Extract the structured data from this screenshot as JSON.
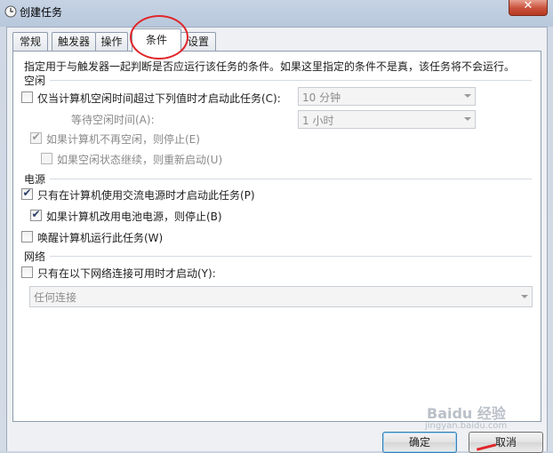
{
  "window": {
    "title": "创建任务",
    "close_glyph": "✕"
  },
  "tabs": [
    {
      "label": "常规",
      "active": false
    },
    {
      "label": "触发器",
      "active": false
    },
    {
      "label": "操作",
      "active": false
    },
    {
      "label": "条件",
      "active": true
    },
    {
      "label": "设置",
      "active": false
    }
  ],
  "conditions": {
    "description": "指定用于与触发器一起判断是否应运行该任务的条件。如果这里指定的条件不是真，该任务将不会运行。",
    "idle": {
      "heading": "空闲",
      "start_only_if_idle": {
        "label": "仅当计算机空闲时间超过下列值时才启动此任务(C):",
        "checked": false
      },
      "idle_duration": {
        "value": "10 分钟"
      },
      "wait_for_idle": {
        "label": "等待空闲时间(A):",
        "value": "1 小时"
      },
      "stop_if_not_idle": {
        "label": "如果计算机不再空闲，则停止(E)",
        "checked": true,
        "enabled": false
      },
      "restart_if_idle_resumes": {
        "label": "如果空闲状态继续，则重新启动(U)",
        "checked": false,
        "enabled": false
      }
    },
    "power": {
      "heading": "电源",
      "ac_power_only": {
        "label": "只有在计算机使用交流电源时才启动此任务(P)",
        "checked": true
      },
      "stop_on_battery": {
        "label": "如果计算机改用电池电源，则停止(B)",
        "checked": true
      },
      "wake_to_run": {
        "label": "唤醒计算机运行此任务(W)",
        "checked": false
      }
    },
    "network": {
      "heading": "网络",
      "network_only": {
        "label": "只有在以下网络连接可用时才启动(Y):",
        "checked": false
      },
      "connection": {
        "value": "任何连接"
      }
    }
  },
  "buttons": {
    "ok": "确定",
    "cancel": "取消"
  },
  "check_glyph": "✔",
  "watermark": {
    "brand": "Baidu 经验",
    "sub": "jingyan.baidu.com"
  },
  "colors": {
    "annotation": "#e0262a",
    "title_bar": "#b8c8dc",
    "close_button": "#c9503a"
  },
  "icons": {
    "app": "clock-icon",
    "close": "close-icon",
    "dropdown": "chevron-down-icon"
  }
}
